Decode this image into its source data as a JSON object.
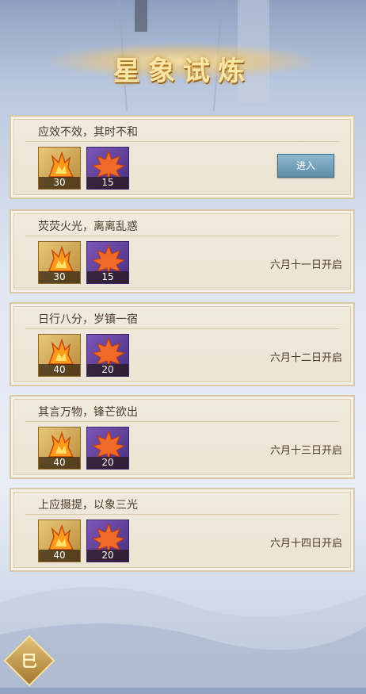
{
  "title": "星象试炼",
  "cards": [
    {
      "title": "应效不效，其时不和",
      "items": [
        {
          "count": "30"
        },
        {
          "count": "15"
        }
      ],
      "action": "进入",
      "date": ""
    },
    {
      "title": "荧荧火光，离离乱惑",
      "items": [
        {
          "count": "30"
        },
        {
          "count": "15"
        }
      ],
      "action": "",
      "date": "六月十一日开启"
    },
    {
      "title": "日行八分，岁镇一宿",
      "items": [
        {
          "count": "40"
        },
        {
          "count": "20"
        }
      ],
      "action": "",
      "date": "六月十二日开启"
    },
    {
      "title": "其言万物，锋芒欲出",
      "items": [
        {
          "count": "40"
        },
        {
          "count": "20"
        }
      ],
      "action": "",
      "date": "六月十三日开启"
    },
    {
      "title": "上应摄提，以象三光",
      "items": [
        {
          "count": "40"
        },
        {
          "count": "20"
        }
      ],
      "action": "",
      "date": "六月十四日开启"
    }
  ],
  "corner_button": {
    "label": "巳",
    "icon": "back-diamond-icon"
  },
  "colors": {
    "gold_item": "#d7b060",
    "purple_item": "#5e3f98",
    "enter_button": "#7aa6be"
  }
}
